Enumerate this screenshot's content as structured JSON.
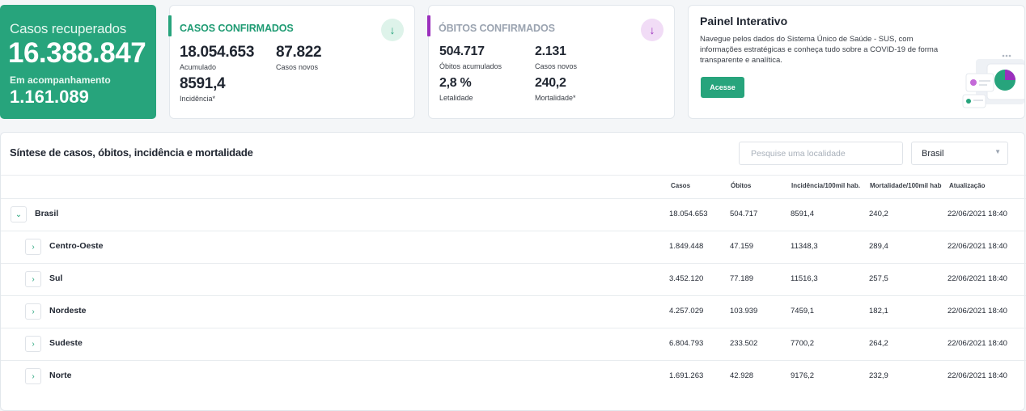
{
  "recovered": {
    "label": "Casos recuperados",
    "value": "16.388.847",
    "follow_label": "Em acompanhamento",
    "follow_value": "1.161.089"
  },
  "confirmed": {
    "title": "CASOS CONFIRMADOS",
    "accumulated": "18.054.653",
    "accumulated_label": "Acumulado",
    "new": "87.822",
    "new_label": "Casos novos",
    "incidence": "8591,4",
    "incidence_label": "Incidência*"
  },
  "deaths": {
    "title": "ÓBITOS CONFIRMADOS",
    "accumulated": "504.717",
    "accumulated_label": "Óbitos acumulados",
    "new": "2.131",
    "new_label": "Casos novos",
    "lethality": "2,8 %",
    "lethality_label": "Letalidade",
    "mortality": "240,2",
    "mortality_label": "Mortalidade*"
  },
  "panel": {
    "title": "Painel Interativo",
    "description": "Navegue pelos dados do Sistema Único de Saúde - SUS, com informações estratégicas e conheça tudo sobre a COVID-19 de forma transparente e analítica.",
    "button": "Acesse"
  },
  "synthesis": {
    "title": "Síntese de casos, óbitos, incidência e mortalidade",
    "search_placeholder": "Pesquise uma localidade",
    "select_value": "Brasil",
    "columns": [
      "Casos",
      "Óbitos",
      "Incidência/100mil hab.",
      "Mortalidade/100mil hab",
      "Atualização"
    ],
    "rows": [
      {
        "name": "Brasil",
        "casos": "18.054.653",
        "obitos": "504.717",
        "incidencia": "8591,4",
        "mortalidade": "240,2",
        "atualizacao": "22/06/2021 18:40"
      },
      {
        "name": "Centro-Oeste",
        "casos": "1.849.448",
        "obitos": "47.159",
        "incidencia": "11348,3",
        "mortalidade": "289,4",
        "atualizacao": "22/06/2021 18:40"
      },
      {
        "name": "Sul",
        "casos": "3.452.120",
        "obitos": "77.189",
        "incidencia": "11516,3",
        "mortalidade": "257,5",
        "atualizacao": "22/06/2021 18:40"
      },
      {
        "name": "Nordeste",
        "casos": "4.257.029",
        "obitos": "103.939",
        "incidencia": "7459,1",
        "mortalidade": "182,1",
        "atualizacao": "22/06/2021 18:40"
      },
      {
        "name": "Sudeste",
        "casos": "6.804.793",
        "obitos": "233.502",
        "incidencia": "7700,2",
        "mortalidade": "264,2",
        "atualizacao": "22/06/2021 18:40"
      },
      {
        "name": "Norte",
        "casos": "1.691.263",
        "obitos": "42.928",
        "incidencia": "9176,2",
        "mortalidade": "232,9",
        "atualizacao": "22/06/2021 18:40"
      }
    ]
  }
}
